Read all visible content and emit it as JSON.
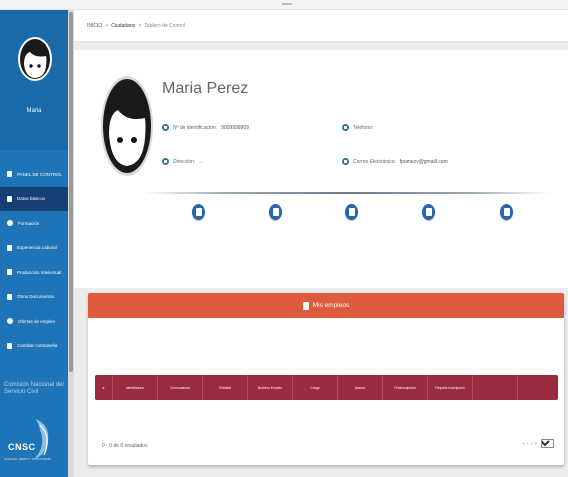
{
  "sidebar": {
    "user_name": "Maria",
    "items": [
      {
        "label": "PANEL DE CONTROL",
        "active": false
      },
      {
        "label": "Datos básicos",
        "active": true
      },
      {
        "label": "Formación",
        "active": false
      },
      {
        "label": "Experiencia Laboral",
        "active": false
      },
      {
        "label": "Producción Intelectual",
        "active": false
      },
      {
        "label": "Otros Documentos",
        "active": false
      },
      {
        "label": "Ofertas de empleo",
        "active": false
      },
      {
        "label": "Cambiar contraseña",
        "active": false
      }
    ],
    "brand": "Comisión Nacional del Servicio Civil",
    "logo_text": "CNSC",
    "logo_tagline": "IGUALDAD, MÉRITO Y OPORTUNIDAD",
    "accent": "#1f73b7",
    "active_color": "#163f73"
  },
  "breadcrumb": {
    "home": "INICIO",
    "section": "Ciudadano",
    "current": "Tablero de Control"
  },
  "profile": {
    "name": "Maria Perez",
    "id_label": "Nº de identificación:",
    "id_value": "9009999909",
    "phone_label": "Teléfono:",
    "phone_value": "",
    "address_label": "Dirección:",
    "address_value": "..",
    "email_label": "Correo Electrónico:",
    "email_value": "fpomezv@gmaill.com",
    "action_icons": [
      "id-card-icon",
      "heart-shield-icon",
      "document-icon",
      "list-icon",
      "file-icon"
    ]
  },
  "jobs": {
    "title": "Mis empleos",
    "header_color": "#de5b3d",
    "table_color": "#9a2a3e",
    "columns": [
      "#",
      "Identificador",
      "Convocatoria",
      "Entidad",
      "Número Empleo",
      "Cargo",
      "Asesor",
      "Preinscripción",
      "Reporte Inscripción",
      "",
      ""
    ],
    "empty_text": "0 - 0 de 0 resultados",
    "pager_first": "«",
    "pager_prev": "‹",
    "pager_next": "›",
    "pager_last": "»",
    "page_size": "10"
  }
}
